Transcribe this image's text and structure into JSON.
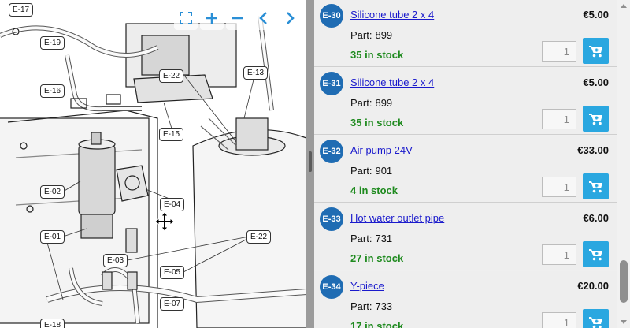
{
  "diagram": {
    "callouts": [
      "E-17",
      "E-19",
      "E-16",
      "E-22",
      "E-13",
      "E-15",
      "E-02",
      "E-04",
      "E-01",
      "E-03",
      "E-22",
      "E-05",
      "E-07",
      "E-18"
    ],
    "toolbar": [
      "fit-icon",
      "zoom-in-icon",
      "zoom-out-icon",
      "previous-icon",
      "next-icon"
    ]
  },
  "parts_list": {
    "part_label": "Part:",
    "items": [
      {
        "badge": "E-30",
        "name": "Silicone tube 2 x 4",
        "price": "€5.00",
        "part": "899",
        "stock": "35 in stock",
        "qty": "1"
      },
      {
        "badge": "E-31",
        "name": "Silicone tube 2 x 4",
        "price": "€5.00",
        "part": "899",
        "stock": "35 in stock",
        "qty": "1"
      },
      {
        "badge": "E-32",
        "name": "Air pump 24V",
        "price": "€33.00",
        "part": "901",
        "stock": "4 in stock",
        "qty": "1"
      },
      {
        "badge": "E-33",
        "name": "Hot water outlet pipe",
        "price": "€6.00",
        "part": "731",
        "stock": "27 in stock",
        "qty": "1"
      },
      {
        "badge": "E-34",
        "name": "Y-piece",
        "price": "€20.00",
        "part": "733",
        "stock": "17 in stock",
        "qty": "1"
      }
    ]
  },
  "colors": {
    "badge": "#1f6cb3",
    "cart": "#2aa7e0",
    "stock": "#1e8a1e",
    "link": "#1a1acc"
  }
}
